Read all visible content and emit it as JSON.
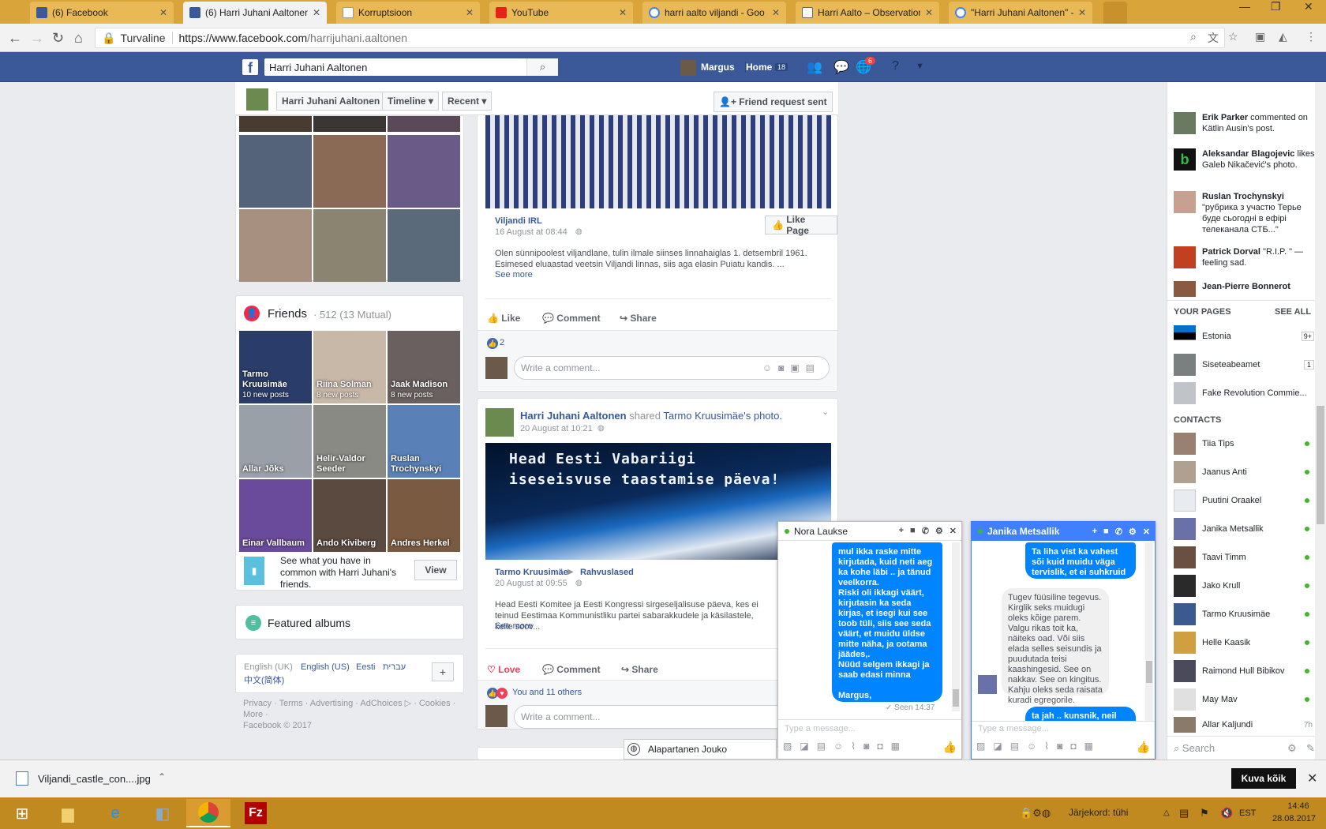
{
  "browser": {
    "tabs": [
      {
        "label": "(6) Facebook"
      },
      {
        "label": "(6) Harri Juhani Aaltonen"
      },
      {
        "label": "Korruptsioon"
      },
      {
        "label": "YouTube"
      },
      {
        "label": "harri aalto viljandi - Goo"
      },
      {
        "label": "Harri Aalto – Observation"
      },
      {
        "label": "\"Harri Juhani Aaltonen\" -"
      }
    ],
    "secure_label": "Turvaline",
    "url_host": "https://www.facebook.com",
    "url_path": "/harrijuhani.aaltonen"
  },
  "fb_header": {
    "search_value": "Harri Juhani Aaltonen",
    "user_name": "Margus",
    "home_label": "Home",
    "home_count": "18",
    "notif_count": "6"
  },
  "profile_bar": {
    "name": "Harri Juhani Aaltonen",
    "timeline": "Timeline",
    "recent": "Recent",
    "friend_request": "Friend request sent"
  },
  "friends": {
    "title": "Friends",
    "count": "· 512 (13 Mutual)",
    "list": [
      {
        "name": "Tarmo Kruusimäe",
        "posts": "10 new posts"
      },
      {
        "name": "Riina Solman",
        "posts": "8 new posts"
      },
      {
        "name": "Jaak Madison",
        "posts": "8 new posts"
      },
      {
        "name": "Allar Jõks",
        "posts": ""
      },
      {
        "name": "Helir-Valdor Seeder",
        "posts": ""
      },
      {
        "name": "Ruslan Trochynskyi",
        "posts": ""
      },
      {
        "name": "Einar Vallbaum",
        "posts": ""
      },
      {
        "name": "Ando Kiviberg",
        "posts": ""
      },
      {
        "name": "Andres Herkel",
        "posts": ""
      }
    ],
    "common_text": "See what you have in common with Harri Juhani's friends.",
    "view_label": "View"
  },
  "featured_albums": "Featured albums",
  "languages": {
    "items": [
      "English (UK)",
      "English (US)",
      "Eesti",
      "עברית",
      "中文(简体)"
    ]
  },
  "footer": {
    "links": [
      "Privacy",
      "Terms",
      "Advertising",
      "AdChoices",
      "Cookies",
      "More"
    ],
    "copyright": "Facebook © 2017"
  },
  "post1": {
    "page_name": "Viljandi IRL",
    "date": "16 August at 08:44",
    "like_page": "Like Page",
    "text": "Olen sünnipoolest viljandlane, tulin ilmale siinses linnahaiglas 1. detsembril 1961. Esimesed eluaastad veetsin Viljandi linnas, siis aga elasin Puiatu kandis. ...",
    "see_more": "See more",
    "like": "Like",
    "comment": "Comment",
    "share": "Share",
    "reactions": "2",
    "comment_placeholder": "Write a comment..."
  },
  "post2": {
    "author": "Harri Juhani Aaltonen",
    "shared": "shared",
    "shared_from": "Tarmo Kruusimäe",
    "shared_suffix": "'s photo.",
    "date": "20 August at 10:21",
    "image_text_1": "Head Eesti Vabariigi",
    "image_text_2": "iseseisvuse taastamise päeva!",
    "orig_author": "Tarmo Kruusimäe",
    "orig_group": "Rahvuslased",
    "orig_date": "20 August at 09:55",
    "text": "Head Eesti Komitee ja Eesti Kongressi sirgeseljalisuse päeva, kes ei teinud Eestimaa Kommunistliku partei sabarakkudele ja käsilastele, kelle soov...",
    "see_more": "See more",
    "love": "Love",
    "comment": "Comment",
    "share": "Share",
    "reactions": "You and 11 others",
    "comment_placeholder": "Write a comment..."
  },
  "ticker": [
    {
      "name": "Erik Parker",
      "text": " commented on Kätlin Ausin's post."
    },
    {
      "name": "Aleksandar Blagojevic",
      "text": " likes Galeb Nikačević's photo."
    },
    {
      "name": "Ruslan Trochynskyi",
      "text": " \"рубрика з участю Терье буде сьогодні в ефірі телеканала СТБ...\""
    },
    {
      "name": "Patrick Dorval",
      "text": " \"R.I.P. \" — feeling sad."
    },
    {
      "name": "Jean-Pierre Bonnerot",
      "text": ""
    }
  ],
  "your_pages": {
    "title": "YOUR PAGES",
    "see_all": "SEE ALL",
    "items": [
      {
        "name": "Estonia",
        "count": "9+"
      },
      {
        "name": "Siseteabeamet",
        "count": "1"
      },
      {
        "name": "Fake Revolution Commie...",
        "count": ""
      }
    ]
  },
  "contacts": {
    "title": "CONTACTS",
    "items": [
      {
        "name": "Tiia Tips",
        "status": ""
      },
      {
        "name": "Jaanus Anti",
        "status": ""
      },
      {
        "name": "Puutini Oraakel",
        "status": ""
      },
      {
        "name": "Janika Metsallik",
        "status": ""
      },
      {
        "name": "Taavi Timm",
        "status": ""
      },
      {
        "name": "Jako Krull",
        "status": ""
      },
      {
        "name": "Tarmo Kruusimäe",
        "status": ""
      },
      {
        "name": "Helle Kaasik",
        "status": ""
      },
      {
        "name": "Raimond Hull Bibikov",
        "status": ""
      },
      {
        "name": "May Mav",
        "status": ""
      },
      {
        "name": "Allar Kaljundi",
        "status": "7h"
      }
    ],
    "search_placeholder": "Search"
  },
  "chat1": {
    "name": "Nora Laukse",
    "message": "mul ikka raske mitte kirjutada, kuid neti aeg ka kohe läbi .. ja tänud veelkorra.\nRiski oli ikkagi väärt, kirjutasin ka seda kirjas, et isegi kui see toob tüli, siis see seda väärt, et muidu üldse mitte näha, ja ootama jäädes,.\nNüüd selgem ikkagi ja saab edasi minna\n\nMargus,\nMaailmaparandaja",
    "seen": "Seen 14:37",
    "input_placeholder": "Type a message..."
  },
  "chat2": {
    "name": "Janika Metsallik",
    "msg_me_1": "Ta liha vist ka vahest sõi kuid muidu väga tervislik, et ei suhkruid ega rämpsu",
    "msg_them": "Tugev füüsiline tegevus. Kirglik seks muidugi oleks kõige parem. Valgu rikas toit ka, näiteks oad. Või siis elada selles seisundis ja puudutada teisi kaashingesid. See on nakkav. See on kingitus. Kahju oleks seda raisata kuradi egregorile.",
    "msg_me_2": "ta jah .. kunsnik, neil see",
    "input_placeholder": "Type a message..."
  },
  "bottom_chat": {
    "name": "Alapartanen Jouko"
  },
  "downloads": {
    "file": "Viljandi_castle_con....jpg",
    "show_all": "Kuva kõik"
  },
  "taskbar": {
    "queue": "Järjekord: tühi",
    "lang": "EST",
    "time": "14:46",
    "date": "28.08.2017"
  }
}
